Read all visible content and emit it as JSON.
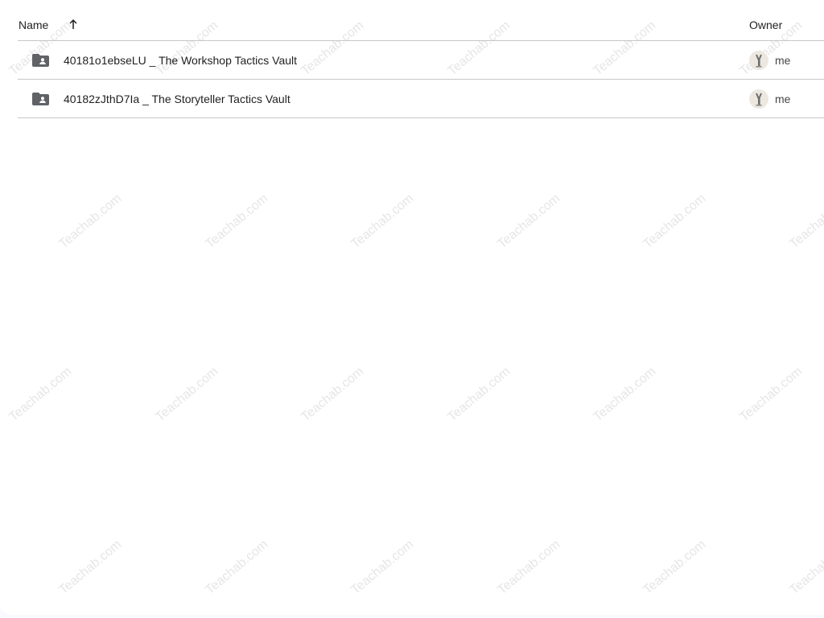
{
  "list": {
    "columns": {
      "name": "Name",
      "owner": "Owner"
    },
    "sort": {
      "icon": "arrow-up-icon",
      "direction": "ascending"
    },
    "rows": [
      {
        "name": "40181o1ebseLU _ The Workshop Tactics Vault",
        "icon": "shared-folder-icon",
        "owner": "me"
      },
      {
        "name": "40182zJthD7Ia _ The Storyteller Tactics Vault",
        "icon": "shared-folder-icon",
        "owner": "me"
      }
    ]
  },
  "watermark": {
    "text": "Teachab.com",
    "color": "#e6e6e6"
  },
  "colors": {
    "text": "#1f1f1f",
    "secondary_text": "#444746",
    "divider": "#c7c7c7",
    "folder_icon": "#5f6368",
    "background": "#f8fafd"
  }
}
